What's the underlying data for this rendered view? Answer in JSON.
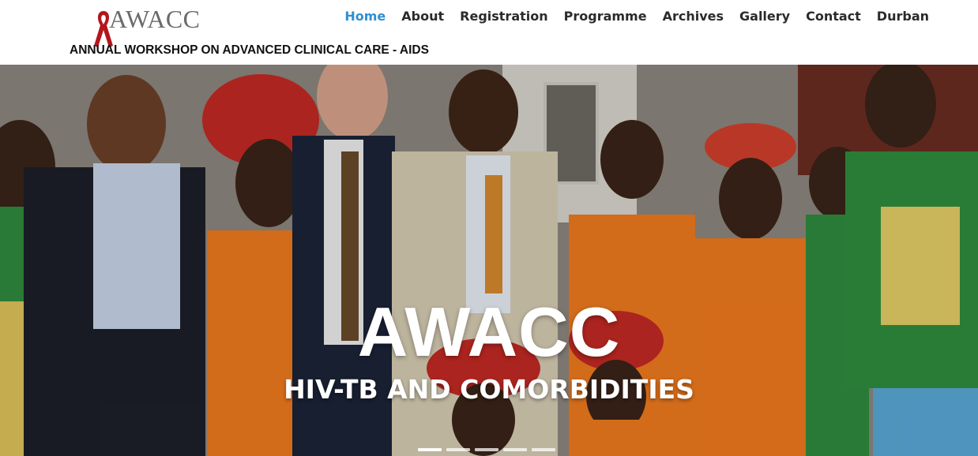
{
  "site": {
    "logo_text": "AWACC",
    "tagline": "ANNUAL WORKSHOP ON ADVANCED CLINICAL CARE - AIDS"
  },
  "nav": [
    {
      "label": "Home",
      "active": true
    },
    {
      "label": "About"
    },
    {
      "label": "Registration"
    },
    {
      "label": "Programme"
    },
    {
      "label": "Archives"
    },
    {
      "label": "Gallery"
    },
    {
      "label": "Contact"
    },
    {
      "label": "Durban"
    }
  ],
  "hero": {
    "title": "AWACC",
    "subtitle": "HIV-TB AND COMORBIDITIES",
    "slide_count": 5
  },
  "colors": {
    "accent": "#2f8fd0",
    "ribbon": "#b3161c",
    "orange": "#f07a1e"
  }
}
